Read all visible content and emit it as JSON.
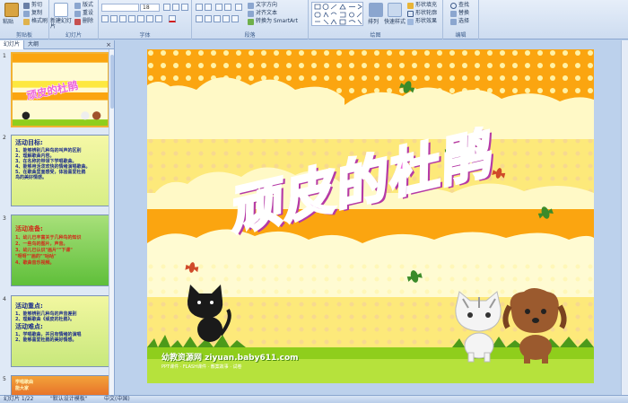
{
  "ribbon": {
    "clipboard": {
      "label": "剪贴板",
      "paste": "粘贴",
      "cut": "剪切",
      "copy": "复制",
      "format_painter": "格式刷"
    },
    "slides": {
      "label": "幻灯片",
      "new_slide": "新建幻灯片",
      "layout": "版式",
      "reset": "重设",
      "delete": "删除"
    },
    "font": {
      "label": "字体",
      "font_size": "18"
    },
    "paragraph": {
      "label": "段落",
      "text_direction": "文字方向",
      "align_text": "对齐文本",
      "smartart": "转换为 SmartArt"
    },
    "drawing": {
      "label": "绘图",
      "arrange": "排列",
      "quick_styles": "快速样式",
      "shape_fill": "形状填充",
      "shape_outline": "形状轮廓",
      "shape_effects": "形状效果"
    },
    "editing": {
      "label": "编辑",
      "find": "查找",
      "replace": "替换",
      "select": "选择"
    }
  },
  "panel": {
    "tabs": [
      "幻灯片",
      "大纲"
    ],
    "close": "×",
    "slides": [
      {
        "num": "1"
      },
      {
        "num": "2",
        "heading": "活动目标:",
        "lines": [
          "1、能够辨别几种鸟的叫声的区别",
          "2、理解歌曲内容。",
          "3、在名称的带领下学唱歌曲。",
          "4、能够用活泼欢快的情绪演唱歌曲。",
          "5、在歌曲里面感受，体验喜爱杜鹃",
          "鸟的美好情感。"
        ]
      },
      {
        "num": "3",
        "heading": "活动准备:",
        "lines": [
          "1、幼儿已丰富关于几种鸟的知识",
          "2、一些鸟的图片，声音。",
          "3、幼儿已认识\"画片\"\"下课\"",
          "\"呀呀\"\"画的\"\"咕咕\"",
          "4、歌曲音乐视频。"
        ]
      },
      {
        "num": "4",
        "heading": "活动重点:",
        "lines": [
          "1、能够辨别几种鸟的声音差别",
          "2、理解歌曲《顽皮的杜鹃》。"
        ],
        "heading2": "活动难点:",
        "lines2": [
          "1、学唱歌曲，并且有情绪的演唱",
          "2、能够喜爱杜鹃的美好情感。"
        ]
      },
      {
        "num": "5",
        "lines": [
          "学唱歌曲",
          "能大家"
        ]
      }
    ]
  },
  "slide": {
    "title": "顽皮的杜鹃",
    "watermark": "幼教资源网 ziyuan.baby611.com",
    "watermark_sub": "PPT课件 · FLASH课件 · 教案故事 · 试卷"
  },
  "status": {
    "slide_info": "幻灯片 1/22",
    "theme": "\"默认设计模板\"",
    "language": "中文(中国)"
  },
  "colors": {
    "title_fill": "#ee63d9",
    "title_outline": "#ffffff",
    "stripe_orange": "#fba510",
    "stripe_yellow": "#fde83f",
    "grass": "#8fce1c",
    "accent": "#f2b233"
  }
}
